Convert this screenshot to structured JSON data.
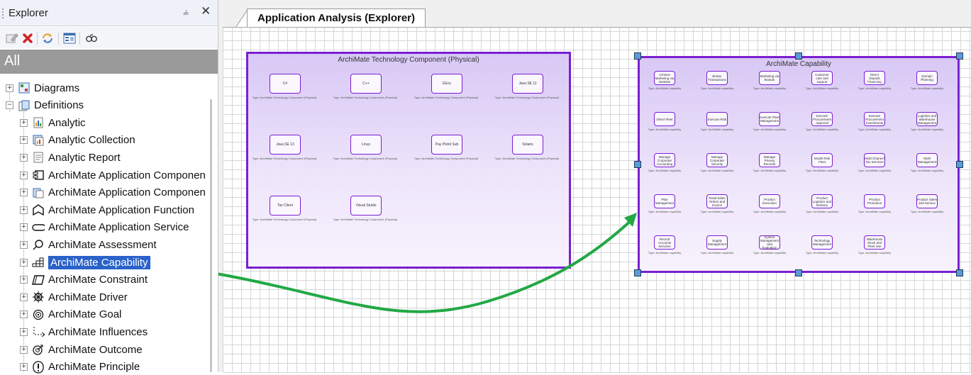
{
  "explorer": {
    "title": "Explorer",
    "pin_glyph": "ᵖ",
    "close_glyph": "×",
    "all_label": "All",
    "tree": [
      {
        "label": "Diagrams",
        "icon": "diagram-icon",
        "level": 0,
        "expander": "+"
      },
      {
        "label": "Definitions",
        "icon": "definitions-icon",
        "level": 0,
        "expander": "−"
      },
      {
        "label": "Analytic",
        "icon": "analytic-icon",
        "level": 1,
        "expander": "+"
      },
      {
        "label": "Analytic Collection",
        "icon": "analytic-collection-icon",
        "level": 1,
        "expander": "+"
      },
      {
        "label": "Analytic Report",
        "icon": "report-icon",
        "level": 1,
        "expander": "+"
      },
      {
        "label": "ArchiMate Application Componen",
        "icon": "component-icon",
        "level": 1,
        "expander": "+"
      },
      {
        "label": "ArchiMate Application Componen",
        "icon": "component-type-icon",
        "level": 1,
        "expander": "+"
      },
      {
        "label": "ArchiMate Application Function",
        "icon": "function-icon",
        "level": 1,
        "expander": "+"
      },
      {
        "label": "ArchiMate Application Service",
        "icon": "service-icon",
        "level": 1,
        "expander": "+"
      },
      {
        "label": "ArchiMate Assessment",
        "icon": "assessment-icon",
        "level": 1,
        "expander": "+"
      },
      {
        "label": "ArchiMate Capability",
        "icon": "capability-icon",
        "level": 1,
        "expander": "+",
        "selected": true
      },
      {
        "label": "ArchiMate Constraint",
        "icon": "constraint-icon",
        "level": 1,
        "expander": "+"
      },
      {
        "label": "ArchiMate Driver",
        "icon": "driver-icon",
        "level": 1,
        "expander": "+"
      },
      {
        "label": "ArchiMate Goal",
        "icon": "goal-icon",
        "level": 1,
        "expander": "+"
      },
      {
        "label": "ArchiMate Influences",
        "icon": "influences-icon",
        "level": 1,
        "expander": "+"
      },
      {
        "label": "ArchiMate Outcome",
        "icon": "outcome-icon",
        "level": 1,
        "expander": "+"
      },
      {
        "label": "ArchiMate Principle",
        "icon": "principle-icon",
        "level": 1,
        "expander": "+"
      }
    ]
  },
  "document": {
    "tab_title": "Application Analysis (Explorer)"
  },
  "tech_frame": {
    "title": "ArchiMate Technology Component (Physical)",
    "type_caption": "Type: ArchiMate Technology Component (Physical)",
    "items": [
      "C#",
      "C++",
      "EEcs",
      "Java SE 11",
      "Java SE 13",
      "Linux",
      "Pay Pistol Sub",
      "Solaris",
      "Tax Client",
      "Visual Studio"
    ]
  },
  "cap_frame": {
    "title": "ArchiMate Capability",
    "type_caption": "Type: ArchiMate capability",
    "items": [
      "Achieve Marketing via Website",
      "Broker Transactions",
      "Marketing via Brands",
      "Customer care and support",
      "Direct Deposit Financing",
      "Domain Planning",
      "Direct Fleet",
      "Execute Risk",
      "Execute Fleet Management",
      "Execute Procurement Approval",
      "Execute Procurement Investments",
      "Logistics and Warehouse Management",
      "Manage Corporate Accounting",
      "Manage Corporate Security",
      "Manage Privacy Records",
      "Model Risk Fleet",
      "Multi Channel Tax Services",
      "Multi Management",
      "Plan Management",
      "Read Sales Orders and Invoice",
      "Product Execution",
      "Product Logistics and Delivery",
      "Product Promotion",
      "Product Sales and Service",
      "Recruit Accounts Services",
      "Supply Management",
      "System Management and Evaluation",
      "Technology Management",
      "Warehouse Stock and Fleet Use"
    ]
  },
  "colors": {
    "frame_border": "#7a1fd1",
    "selection": "#2a62c9",
    "arrow": "#22a845",
    "handle": "#5b9bd5"
  }
}
